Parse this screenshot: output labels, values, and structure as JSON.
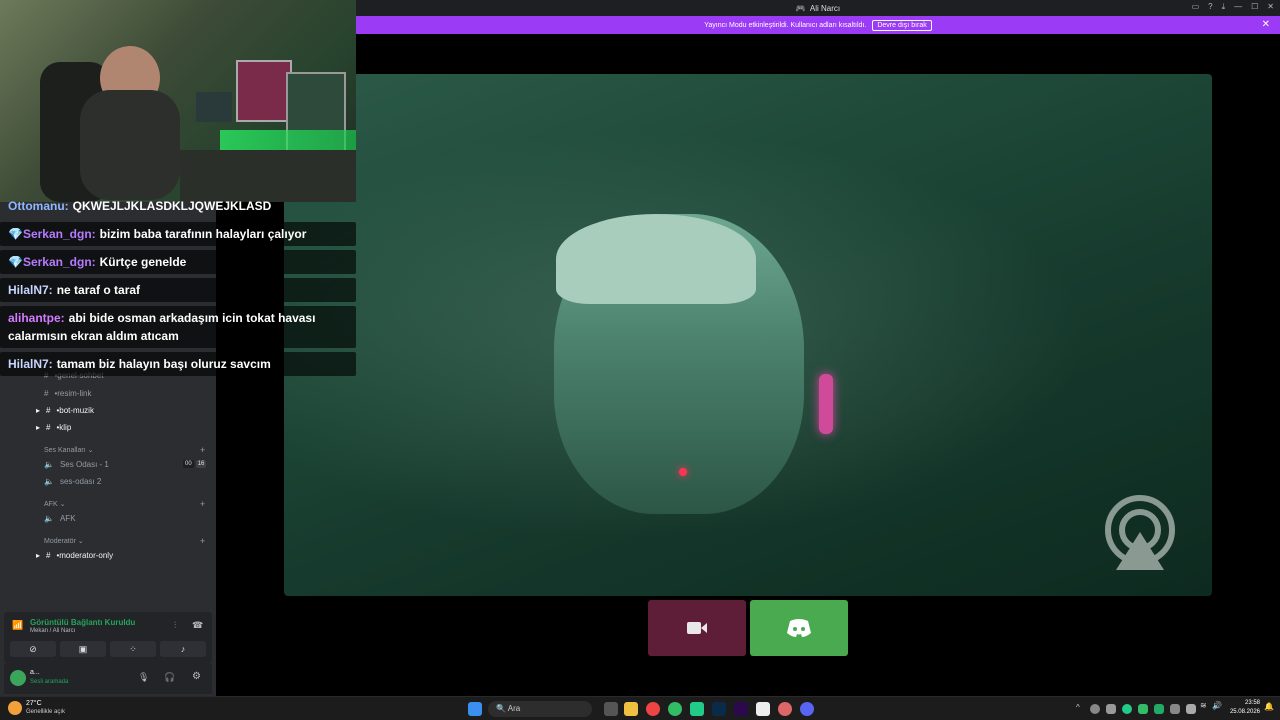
{
  "window": {
    "title": "Ali Narcı"
  },
  "banner": {
    "text": "Yayıncı Modu etkinleştirildi. Kullanıcı adları kısaltıldı.",
    "button": "Devre dışı bırak"
  },
  "chat": [
    {
      "user": "Ottomanu:",
      "text": "QKWEJLJKLASDKLJQWEJKLASD",
      "color": "#8fb8ff",
      "badge": ""
    },
    {
      "user": "Serkan_dgn:",
      "text": "bizim baba tarafının halayları çalıyor",
      "color": "#b57bff",
      "badge": "💎"
    },
    {
      "user": "Serkan_dgn:",
      "text": "Kürtçe genelde",
      "color": "#b57bff",
      "badge": "💎"
    },
    {
      "user": "HilalN7:",
      "text": "ne taraf o taraf",
      "color": "#c8d7ff",
      "badge": ""
    },
    {
      "user": "alihantpe:",
      "text": "abi bide osman arkadaşım icin tokat havası calarmısın ekran aldım atıcam",
      "color": "#d47bff",
      "badge": ""
    },
    {
      "user": "HilalN7:",
      "text": "tamam biz halayın başı oluruz savcım",
      "color": "#c8d7ff",
      "badge": ""
    }
  ],
  "channels": {
    "text": [
      {
        "name": "•genel-sohbet",
        "bright": false
      },
      {
        "name": "•resim-link",
        "bright": false
      },
      {
        "name": "•bot-muzik",
        "bright": true
      },
      {
        "name": "•klip",
        "bright": true
      }
    ],
    "voice_category": "Ses Kanalları",
    "voice": [
      {
        "name": "Ses Odası - 1",
        "badge_a": "00",
        "badge_b": "16"
      },
      {
        "name": "ses-odası 2"
      }
    ],
    "afk_category": "AFK",
    "afk_channel": "AFK",
    "mod_category": "Moderatör",
    "mod_channel": "•moderator-only"
  },
  "voice": {
    "status": "Görüntülü Bağlantı Kuruldu",
    "location": "Mekan / Ali Narcı"
  },
  "user": {
    "name": "a...",
    "status": "Sesli aramada"
  },
  "weather": {
    "temp": "27°C",
    "desc": "Genellikle açık"
  },
  "taskbar": {
    "search": "Ara",
    "time": "23:58",
    "date": "25.08.2026"
  },
  "colors": {
    "accent": "#9b3bf5",
    "cam_btn": "#5e1e38",
    "discord_btn": "#4aaa4f"
  }
}
